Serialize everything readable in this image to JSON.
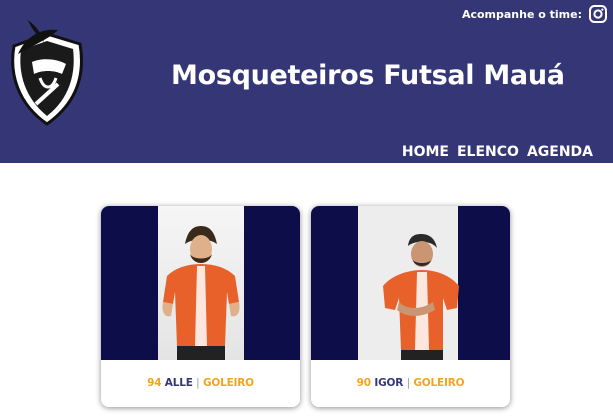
{
  "colors": {
    "brand": "#343676",
    "navy": "#0d0d4a",
    "accent": "#f0a51c",
    "jersey": "#e8612a"
  },
  "header": {
    "follow_text": "Acompanhe o time:",
    "instagram_icon": "instagram-icon",
    "title": "Mosqueteiros Futsal Mauá",
    "logo": "musketeer-shield-logo"
  },
  "nav": {
    "items": [
      {
        "label": "HOME"
      },
      {
        "label": "ELENCO"
      },
      {
        "label": "AGENDA"
      }
    ]
  },
  "players": [
    {
      "number": "94",
      "name": "ALLE",
      "separator": "|",
      "position": "GOLEIRO"
    },
    {
      "number": "90",
      "name": "IGOR",
      "separator": "|",
      "position": "GOLEIRO"
    }
  ]
}
